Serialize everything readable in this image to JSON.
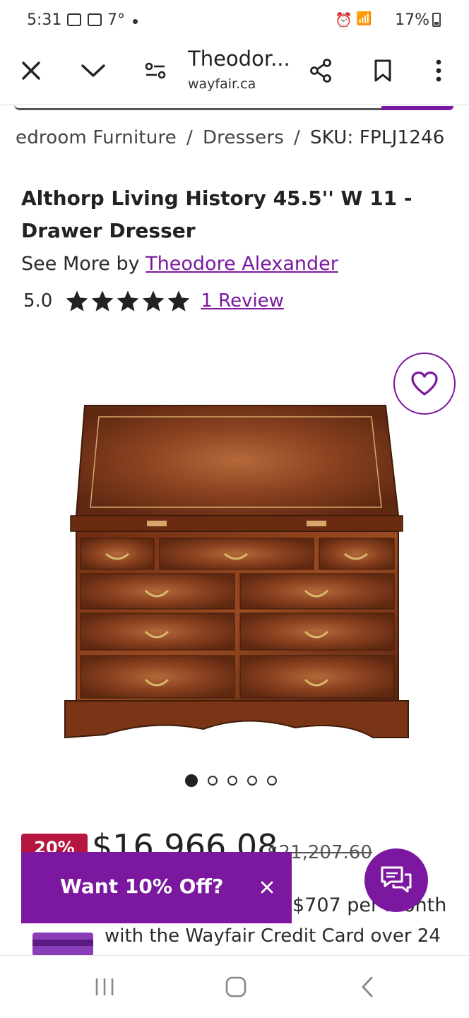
{
  "status": {
    "time": "5:31",
    "temp": "7°",
    "battery": "17%"
  },
  "browser": {
    "title": "Theodor...",
    "url": "wayfair.ca"
  },
  "breadcrumb": {
    "part1": "edroom Furniture",
    "sep": "/",
    "part2": "Dressers",
    "sku": "SKU: FPLJ1246"
  },
  "product": {
    "title": "Althorp Living History 45.5'' W 11 - Drawer Dresser",
    "see_more_prefix": "See More by",
    "brand": "Theodore Alexander",
    "rating": "5.0",
    "stars": 5,
    "reviews": "1 Review"
  },
  "gallery": {
    "count": 5,
    "active": 1
  },
  "pricing": {
    "discount": "20%",
    "price": "$16,966.08",
    "old_price": "$21,207.60",
    "monthly": "$707 per month",
    "credit_line": "with the Wayfair Credit Card over 24"
  },
  "banner": {
    "text": "Want 10% Off?"
  },
  "colors": {
    "accent": "#7b189f",
    "sale": "#b5153f"
  },
  "icons": [
    "close-icon",
    "chevron-down-icon",
    "tune-icon",
    "share-icon",
    "bookmark-icon",
    "more-icon",
    "heart-icon",
    "chat-icon",
    "recents-icon",
    "home-icon",
    "back-icon"
  ]
}
